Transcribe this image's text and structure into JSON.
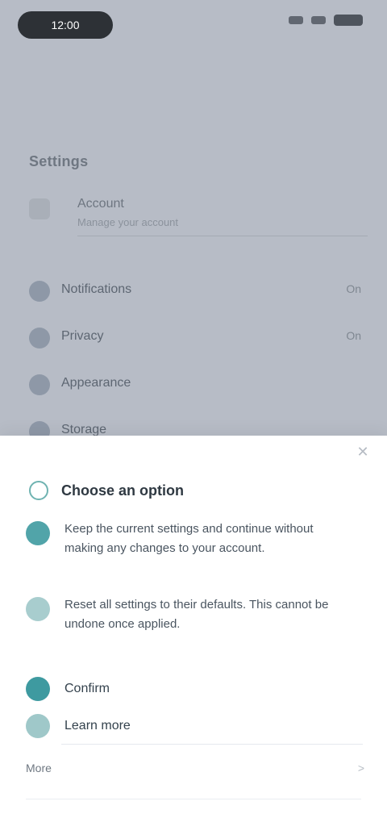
{
  "status": {
    "time": "12:00"
  },
  "top": {
    "header": "Settings",
    "subtitle": "Account",
    "subnote": "Manage your account",
    "items": [
      {
        "label": "Notifications",
        "value": "On"
      },
      {
        "label": "Privacy",
        "value": "On"
      },
      {
        "label": "Appearance",
        "value": ""
      },
      {
        "label": "Storage",
        "value": ""
      }
    ]
  },
  "sheet": {
    "title": "Choose an option",
    "option1": "Keep the current settings and continue without making any changes to your account.",
    "option2": "Reset all settings to their defaults. This cannot be undone once applied.",
    "row1": "Confirm",
    "row2": "Learn more",
    "footer_left": "More",
    "footer_right": ">"
  },
  "colors": {
    "accent": "#3e9aa0",
    "overlay": "#b7bcc6"
  }
}
